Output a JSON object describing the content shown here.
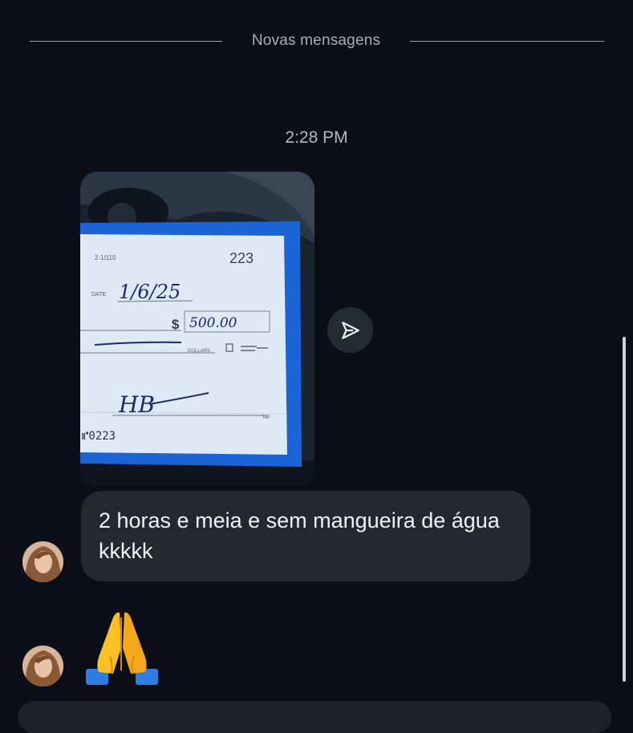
{
  "divider": {
    "label": "Novas mensagens"
  },
  "timestamp": "2:28 PM",
  "photo": {
    "cheque_number": "223",
    "routing_small": "2-1/110",
    "date_label": "DATE",
    "date_value": "1/6/25",
    "dollar_sign": "$",
    "amount": "500.00",
    "dollars_label": "DOLLARS",
    "memo_label": "MP",
    "signature": "HB",
    "micr": "⑈0223"
  },
  "message": {
    "text": "2 horas e meia e sem mangueira de água kkkkk"
  },
  "reaction": {
    "emoji": "folded-hands"
  },
  "icons": {
    "share": "send-icon"
  },
  "colors": {
    "background": "#0c0f18",
    "bubble": "#25282f",
    "cheque_border": "#1b64d6",
    "cheque_paper": "#dfe9f3"
  }
}
